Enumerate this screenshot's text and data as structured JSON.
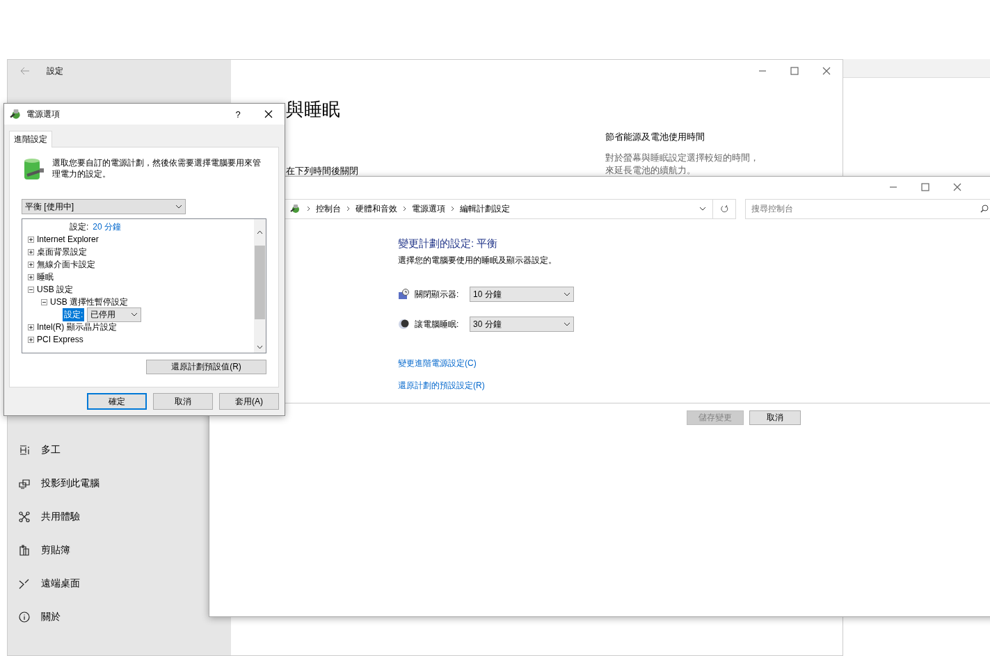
{
  "settings_window": {
    "title": "設定",
    "heading": "與睡眠",
    "section_text": "在下列時間後關閉",
    "side_panel": {
      "title": "節省能源及電池使用時間",
      "lines": [
        "對於螢幕與睡眠設定選擇較短的時間，",
        "來延長電池的續航力。"
      ]
    },
    "sidebar": {
      "items": [
        {
          "label": "多工",
          "kind": "multitask"
        },
        {
          "label": "投影到此電腦",
          "kind": "project"
        },
        {
          "label": "共用體驗",
          "kind": "share"
        },
        {
          "label": "剪貼簿",
          "kind": "clipboard"
        },
        {
          "label": "遠端桌面",
          "kind": "remote"
        },
        {
          "label": "關於",
          "kind": "about"
        }
      ]
    }
  },
  "control_panel": {
    "breadcrumbs": [
      "控制台",
      "硬體和音效",
      "電源選項",
      "編輯計劃設定"
    ],
    "search": {
      "placeholder": "搜尋控制台"
    },
    "heading": "變更計劃的設定: 平衡",
    "subtitle": "選擇您的電腦要使用的睡眠及顯示器設定。",
    "settings": [
      {
        "kind": "display",
        "label": "關閉顯示器:",
        "value": "10 分鐘"
      },
      {
        "kind": "sleep",
        "label": "讓電腦睡眠:",
        "value": "30 分鐘"
      }
    ],
    "links": [
      "變更進階電源設定(C)",
      "還原計劃的預設設定(R)"
    ],
    "buttons": [
      {
        "label": "儲存變更",
        "disabled": true
      },
      {
        "label": "取消",
        "disabled": false
      }
    ]
  },
  "dialog": {
    "title": "電源選項",
    "help": "?",
    "tabs": [
      {
        "label": "進階設定",
        "selected": true
      }
    ],
    "description": "選取您要自訂的電源計劃，然後依需要選擇電腦要用來管理電力的設定。",
    "plan": "平衡 [使用中]",
    "tree": [
      {
        "kind": "setting",
        "label": "設定:",
        "value": "20 分鐘",
        "selected": false
      },
      {
        "kind": "group",
        "label": "Internet Explorer",
        "expanded": false
      },
      {
        "kind": "group",
        "label": "桌面背景設定",
        "expanded": false
      },
      {
        "kind": "group",
        "label": "無線介面卡設定",
        "expanded": false
      },
      {
        "kind": "group",
        "label": "睡眠",
        "expanded": false
      },
      {
        "kind": "group",
        "label": "USB 設定",
        "expanded": true,
        "children": [
          {
            "kind": "group",
            "label": "USB 選擇性暫停設定",
            "expanded": true,
            "children": [
              {
                "kind": "choice",
                "label": "設定:",
                "value": "已停用",
                "selected": true
              }
            ]
          }
        ]
      },
      {
        "kind": "group",
        "label": "Intel(R) 顯示晶片設定",
        "expanded": false
      },
      {
        "kind": "group",
        "label": "PCI Express",
        "expanded": false
      }
    ],
    "restore_button": "還原計劃預設值(R)",
    "buttons": [
      {
        "label": "確定",
        "default": true
      },
      {
        "label": "取消",
        "default": false
      },
      {
        "label": "套用(A)",
        "default": false
      }
    ]
  }
}
